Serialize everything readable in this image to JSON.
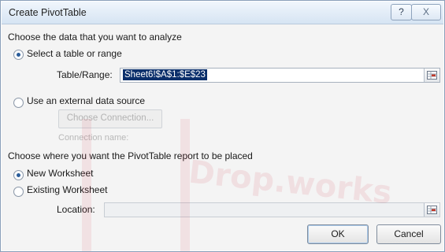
{
  "window": {
    "title": "Create PivotTable",
    "help_label": "?",
    "close_label": "X"
  },
  "data_section": {
    "heading": "Choose the data that you want to analyze",
    "option_table": {
      "label": "Select a table or range",
      "checked": true
    },
    "table_range": {
      "label": "Table/Range:",
      "value": "Sheet6!$A$1:$E$23"
    },
    "option_external": {
      "label": "Use an external data source",
      "checked": false
    },
    "choose_connection_label": "Choose Connection...",
    "connection_name_label": "Connection name:"
  },
  "placement_section": {
    "heading": "Choose where you want the PivotTable report to be placed",
    "option_new": {
      "label": "New Worksheet",
      "checked": true
    },
    "option_existing": {
      "label": "Existing Worksheet",
      "checked": false
    },
    "location": {
      "label": "Location:",
      "value": ""
    }
  },
  "buttons": {
    "ok": "OK",
    "cancel": "Cancel"
  },
  "watermark": {
    "text": "Drop.works"
  },
  "icons": {
    "help": "question-icon",
    "close": "close-icon",
    "collapse": "range-select-icon"
  }
}
